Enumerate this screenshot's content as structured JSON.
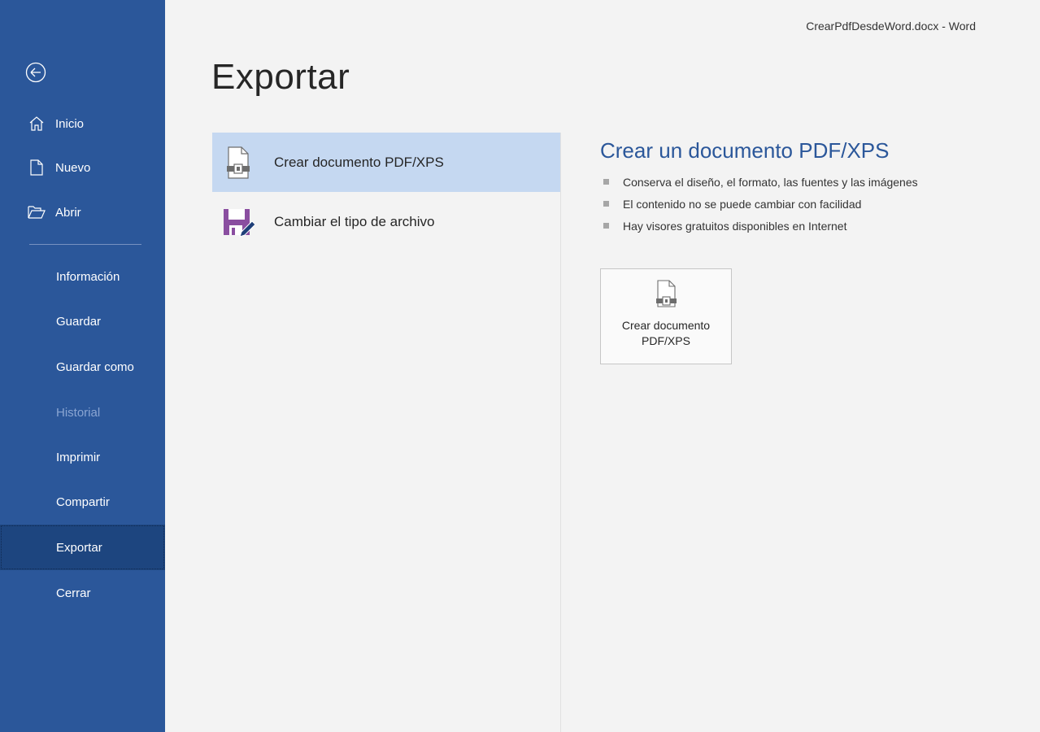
{
  "window": {
    "doc_title": "CrearPdfDesdeWord.docx  -  Word"
  },
  "sidebar": {
    "back_icon": "back-arrow-circle-icon",
    "top_items": [
      {
        "label": "Inicio",
        "icon": "home-icon"
      },
      {
        "label": "Nuevo",
        "icon": "new-document-icon"
      },
      {
        "label": "Abrir",
        "icon": "open-folder-icon"
      }
    ],
    "items": [
      {
        "label": "Información",
        "state": "normal"
      },
      {
        "label": "Guardar",
        "state": "normal"
      },
      {
        "label": "Guardar como",
        "state": "normal"
      },
      {
        "label": "Historial",
        "state": "disabled"
      },
      {
        "label": "Imprimir",
        "state": "normal"
      },
      {
        "label": "Compartir",
        "state": "normal"
      },
      {
        "label": "Exportar",
        "state": "active"
      },
      {
        "label": "Cerrar",
        "state": "normal"
      }
    ],
    "colors": {
      "background": "#2b579a",
      "active": "#1d457f"
    }
  },
  "main": {
    "title": "Exportar",
    "options": [
      {
        "label": "Crear documento PDF/XPS",
        "icon": "pdf-document-icon",
        "selected": true
      },
      {
        "label": "Cambiar el tipo de archivo",
        "icon": "save-edit-icon",
        "selected": false
      }
    ]
  },
  "detail": {
    "title": "Crear un documento PDF/XPS",
    "bullets": [
      "Conserva el diseño, el formato, las fuentes y las imágenes",
      "El contenido no se puede cambiar con facilidad",
      "Hay visores gratuitos disponibles en Internet"
    ],
    "button": {
      "label_line1": "Crear documento",
      "label_line2": "PDF/XPS",
      "icon": "pdf-document-icon"
    }
  }
}
